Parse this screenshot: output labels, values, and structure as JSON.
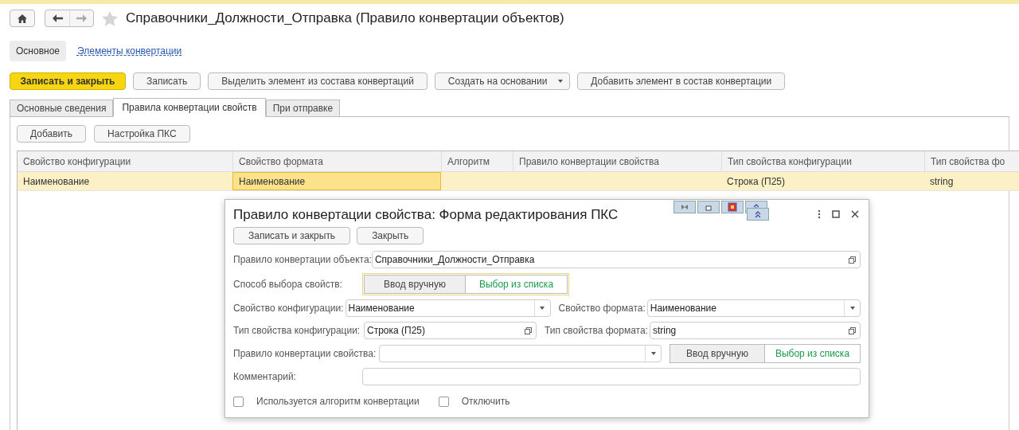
{
  "header": {
    "title": "Справочники_Должности_Отправка (Правило конвертации объектов)",
    "favorite": false
  },
  "nav": [
    {
      "label": "Основное",
      "selected": true
    },
    {
      "label": "Элементы конвертации",
      "selected": false
    }
  ],
  "commands": [
    {
      "label": "Записать и закрыть",
      "kind": "primary"
    },
    {
      "label": "Записать",
      "kind": "plain"
    },
    {
      "label": "Выделить элемент из состава конвертаций",
      "kind": "plain"
    },
    {
      "label": "Создать на основании",
      "kind": "menu"
    },
    {
      "label": "Добавить элемент в состав конвертации",
      "kind": "plain"
    }
  ],
  "tabs": [
    {
      "label": "Основные сведения",
      "selected": false
    },
    {
      "label": "Правила конвертации свойств",
      "selected": true
    },
    {
      "label": "При отправке",
      "selected": false
    }
  ],
  "table_buttons": [
    "Добавить",
    "Настройка ПКС"
  ],
  "table": {
    "columns": [
      "Свойство конфигурации",
      "Свойство формата",
      "Алгоритм",
      "Правило конвертации свойства",
      "Тип свойства конфигурации",
      "Тип свойства фо"
    ],
    "rows": [
      {
        "selected": true,
        "cells": [
          "Наименование",
          "Наименование",
          "",
          "",
          "Строка (П25)",
          "string"
        ]
      }
    ]
  },
  "dialog": {
    "title": "Правило конвертации свойства: Форма редактирования ПКС",
    "buttons": [
      "Записать и закрыть",
      "Закрыть"
    ],
    "object_rule": {
      "label": "Правило конвертации объекта:",
      "value": "Справочники_Должности_Отправка"
    },
    "selection_mode": {
      "label": "Способ выбора свойств:",
      "options": [
        {
          "label": "Ввод вручную",
          "selected": false
        },
        {
          "label": "Выбор из списка",
          "selected": true
        }
      ]
    },
    "config_property": {
      "label": "Свойство конфигурации:",
      "value": "Наименование"
    },
    "format_property": {
      "label": "Свойство формата:",
      "value": "Наименование"
    },
    "config_type": {
      "label": "Тип свойства конфигурации:",
      "value": "Строка (П25)"
    },
    "format_type": {
      "label": "Тип свойства формата:",
      "value": "string"
    },
    "property_rule": {
      "label": "Правило конвертации свойства:",
      "options": [
        {
          "label": "Ввод вручную",
          "selected": false
        },
        {
          "label": "Выбор из списка",
          "selected": true
        }
      ]
    },
    "comment": {
      "label": "Комментарий:"
    },
    "checkboxes": [
      {
        "label": "Используется алгоритм конвертации",
        "checked": false
      },
      {
        "label": "Отключить",
        "checked": false
      }
    ]
  }
}
